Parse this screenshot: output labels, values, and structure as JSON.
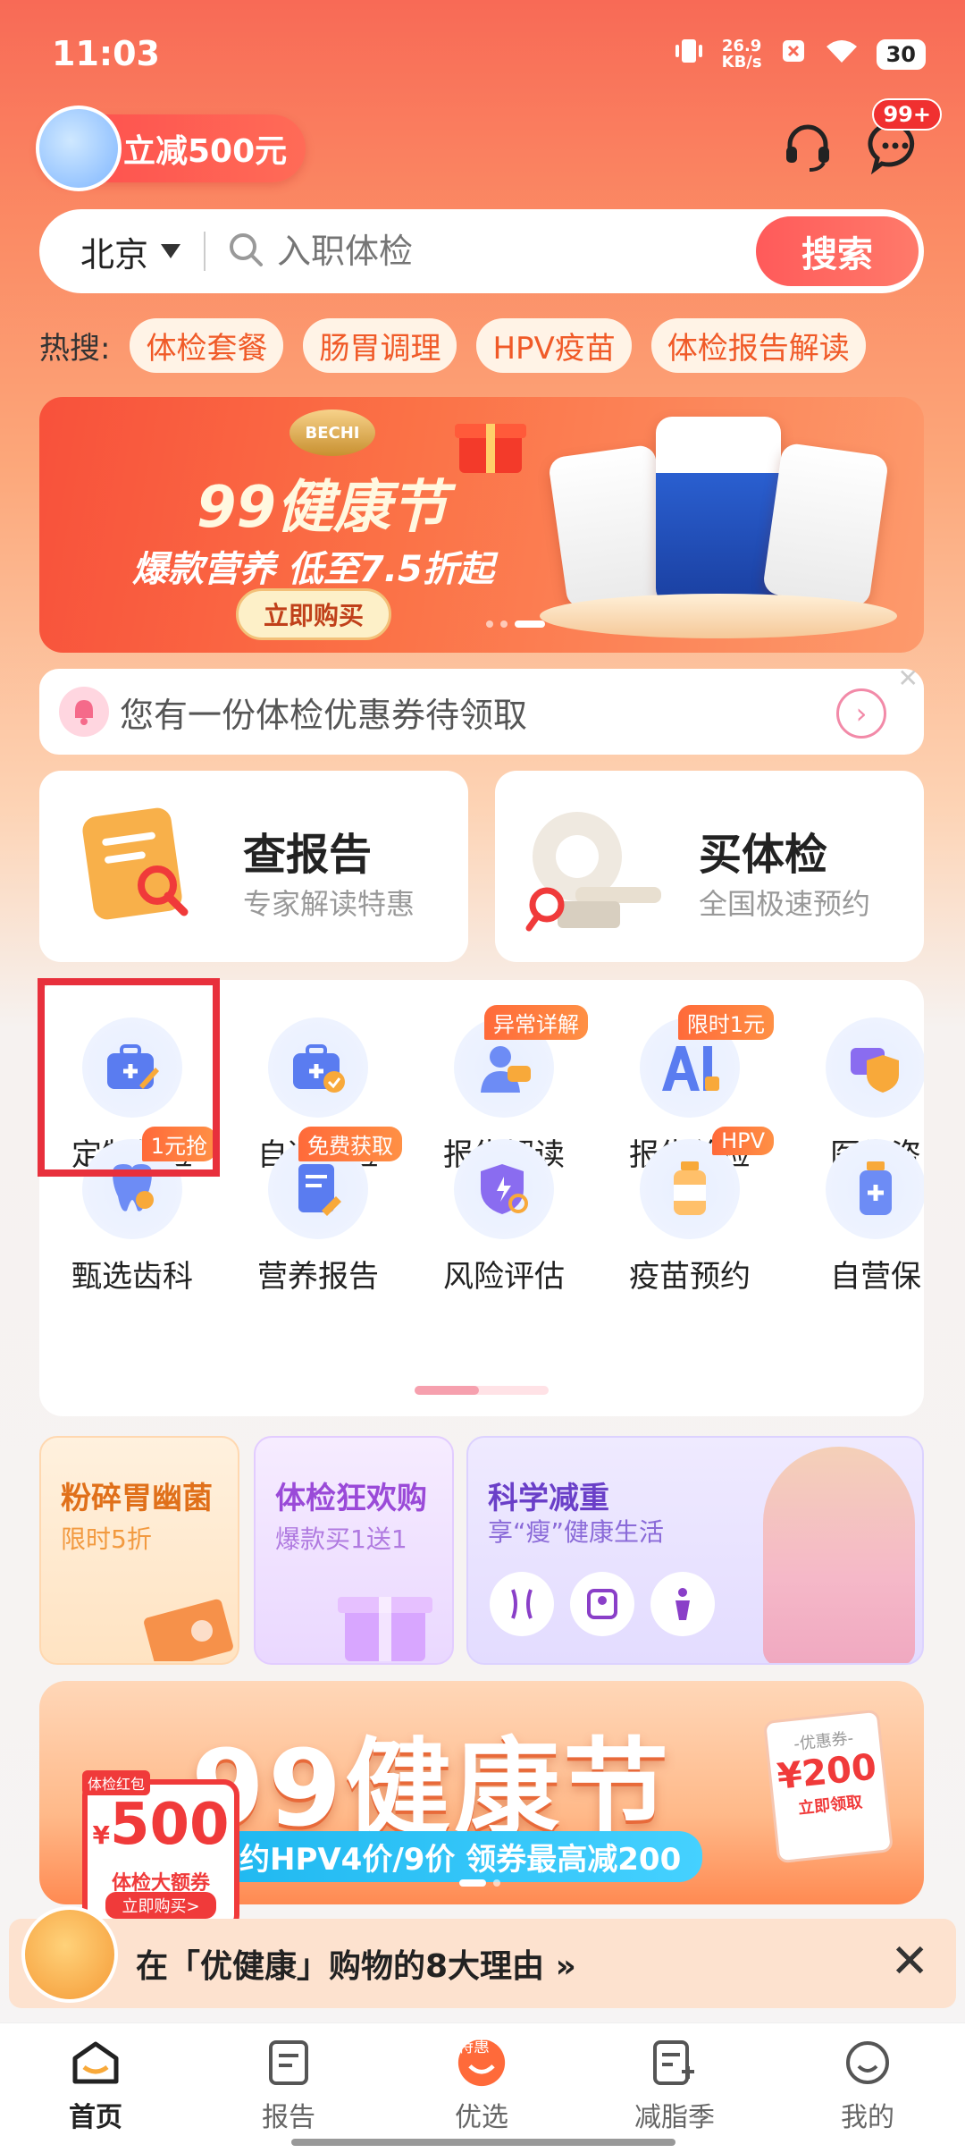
{
  "status_bar": {
    "time": "11:03",
    "speed_value": "26.9",
    "speed_unit": "KB/s",
    "battery": "30"
  },
  "header": {
    "promo_label": "立减500元",
    "message_badge": "99+"
  },
  "search": {
    "city": "北京",
    "placeholder": "入职体检",
    "button": "搜索"
  },
  "hot_search": {
    "label": "热搜:",
    "items": [
      "体检套餐",
      "肠胃调理",
      "HPV疫苗",
      "体检报告解读"
    ]
  },
  "banner": {
    "brand": "BECHI",
    "title": "99健康节",
    "subtitle": "爆款营养 低至7.5折起",
    "button": "立即购买"
  },
  "notice": {
    "text": "您有一份体检优惠券待领取"
  },
  "cards": [
    {
      "title": "查报告",
      "subtitle": "专家解读特惠"
    },
    {
      "title": "买体检",
      "subtitle": "全国极速预约"
    }
  ],
  "grid_row1": [
    {
      "label": "定制体检",
      "tag": ""
    },
    {
      "label": "自选体检",
      "tag": ""
    },
    {
      "label": "报告解读",
      "tag": "异常详解"
    },
    {
      "label": "报告总检",
      "tag": "限时1元"
    },
    {
      "label": "医生咨",
      "tag": ""
    }
  ],
  "grid_row2": [
    {
      "label": "甄选齿科",
      "tag": "1元抢"
    },
    {
      "label": "营养报告",
      "tag": "免费获取"
    },
    {
      "label": "风险评估",
      "tag": ""
    },
    {
      "label": "疫苗预约",
      "tag": "HPV"
    },
    {
      "label": "自营保",
      "tag": ""
    }
  ],
  "tiles": [
    {
      "title": "粉碎胃幽菌",
      "subtitle": "限时5折"
    },
    {
      "title": "体检狂欢购",
      "subtitle": "爆款买1送1"
    },
    {
      "title": "科学减重",
      "subtitle": "享“瘦”健康生活"
    }
  ],
  "big_banner": {
    "title": "99健康节",
    "subtitle": "约HPV4价/9价 领券最高减200",
    "coupon_tag": "体检红包",
    "coupon_amount": "500",
    "coupon_currency": "¥",
    "coupon_label": "体检大额券",
    "coupon_button": "立即购买>",
    "coupon2_title": "-优惠券-",
    "coupon2_amount": "¥200",
    "coupon2_action": "立即领取"
  },
  "reason_bar": {
    "text": "在「优健康」购物的8大理由 »"
  },
  "tabbar": [
    {
      "label": "首页",
      "active": true
    },
    {
      "label": "报告",
      "active": false
    },
    {
      "label": "优选",
      "active": false,
      "badge": "特惠"
    },
    {
      "label": "减脂季",
      "active": false
    },
    {
      "label": "我的",
      "active": false
    }
  ],
  "colors": {
    "accent": "#ff5a5a",
    "tag_orange": "#ff7a3a",
    "highlight": "#e8303c"
  }
}
